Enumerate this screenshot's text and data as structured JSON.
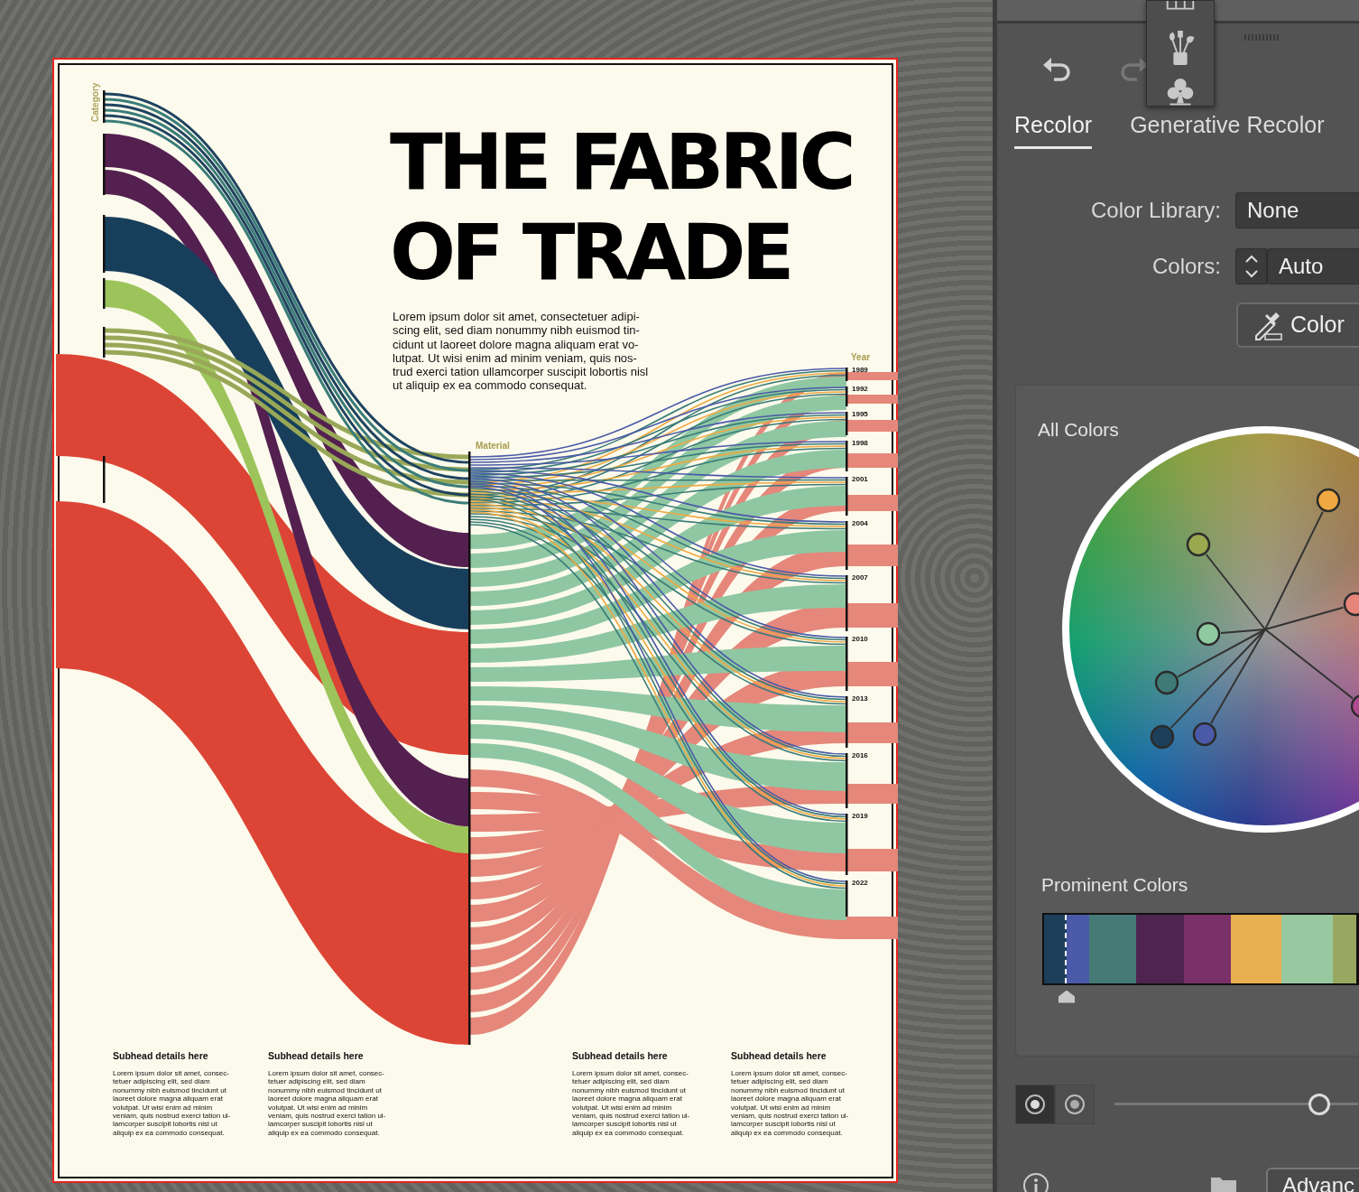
{
  "artboard": {
    "title_lines": [
      "THE FABRIC",
      "OF TRADE"
    ],
    "intro": "Lorem ipsum dolor sit amet, consectetuer adipi-\nscing elit, sed diam nonummy nibh euismod tin-\ncidunt ut laoreet dolore magna aliquam erat vo-\nlutpat. Ut wisi enim ad minim veniam, quis nos-\ntrud exerci tation ullamcorper suscipit lobortis nisl\nut aliquip ex ea commodo consequat.",
    "axis_labels": {
      "category": "Category",
      "material": "Material",
      "year": "Year"
    },
    "years": [
      "1989",
      "1992",
      "1995",
      "1998",
      "2001",
      "2004",
      "2007",
      "2010",
      "2013",
      "2016",
      "2019",
      "2022"
    ],
    "subheads": [
      {
        "title": "Subhead details here",
        "body": "Lorem ipsum dolor sit amet, consec-\ntetuer adipiscing elit, sed diam\nnonummy nibh euismod tincidunt ut\nlaoreet dolore magna aliquam erat\nvolutpat. Ut wisi enim ad minim\nveniam, quis nostrud exerci tation ul-\nlamcorper suscipit lobortis nisl ut\naliquip ex ea commodo consequat."
      },
      {
        "title": "Subhead details here",
        "body": "Lorem ipsum dolor sit amet, consec-\ntetuer adipiscing elit, sed diam\nnonummy nibh euismod tincidunt ut\nlaoreet dolore magna aliquam erat\nvolutpat. Ut wisi enim ad minim\nveniam, quis nostrud exerci tation ul-\nlamcorper suscipit lobortis nisl ut\naliquip ex ea commodo consequat."
      },
      {
        "title": "Subhead details here",
        "body": "Lorem ipsum dolor sit amet, consec-\ntetuer adipiscing elit, sed diam\nnonummy nibh euismod tincidunt ut\nlaoreet dolore magna aliquam erat\nvolutpat. Ut wisi enim ad minim\nveniam, quis nostrud exerci tation ul-\nlamcorper suscipit lobortis nisl ut\naliquip ex ea commodo consequat."
      },
      {
        "title": "Subhead details here",
        "body": "Lorem ipsum dolor sit amet, consec-\ntetuer adipiscing elit, sed diam\nnonummy nibh euismod tincidunt ut\nlaoreet dolore magna aliquam erat\nvolutpat. Ut wisi enim ad minim\nveniam, quis nostrud exerci tation ul-\nlamcorper suscipit lobortis nisl ut\naliquip ex ea commodo consequat."
      }
    ]
  },
  "panel": {
    "tabs": [
      {
        "label": "Recolor",
        "selected": true
      },
      {
        "label": "Generative Recolor",
        "selected": false
      }
    ],
    "color_library": {
      "label": "Color Library:",
      "value": "None"
    },
    "colors": {
      "label": "Colors:",
      "value": "Auto"
    },
    "color_theme_button": "Color",
    "all_colors": {
      "title": "All Colors",
      "markers": [
        {
          "color": "#f0a840"
        },
        {
          "color": "#9aa84e"
        },
        {
          "color": "#8fc9a0"
        },
        {
          "color": "#3f7a76"
        },
        {
          "color": "#1e3f5a"
        },
        {
          "color": "#4a5aa8"
        },
        {
          "color": "#e8857a"
        },
        {
          "color": "#b04a90"
        }
      ]
    },
    "prominent_colors": {
      "title": "Prominent Colors",
      "swatches": [
        {
          "color": "#1e3f5a",
          "selected": true
        },
        {
          "color": "#4a5aa8",
          "selected": false
        },
        {
          "color": "#457a76",
          "selected": false
        },
        {
          "color": "#4f2550",
          "selected": false
        },
        {
          "color": "#7a3068",
          "selected": false
        },
        {
          "color": "#e8b050",
          "selected": false
        },
        {
          "color": "#98c8a0",
          "selected": false
        },
        {
          "color": "#98a860",
          "selected": false
        }
      ]
    },
    "view_toggles": [
      {
        "selected": true
      },
      {
        "selected": false
      }
    ],
    "slider": {
      "level": 0.84
    },
    "advanced_button": "Advanc"
  }
}
